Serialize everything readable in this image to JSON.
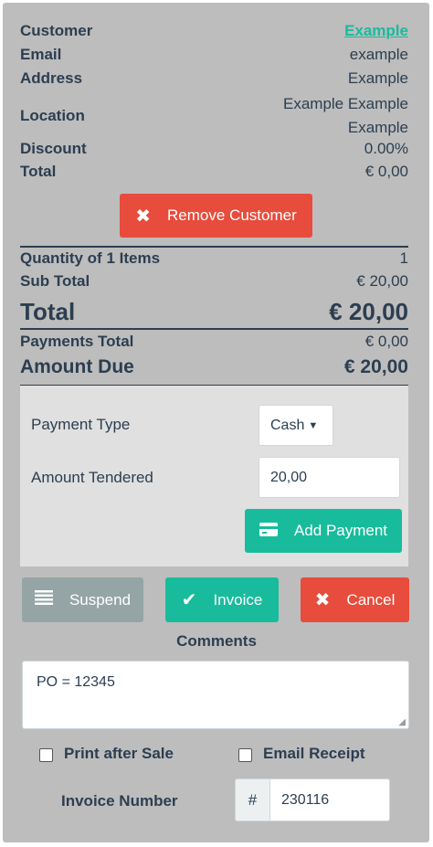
{
  "customer": {
    "customer_label": "Customer",
    "customer_value": "Example",
    "email_label": "Email",
    "email_value": "example",
    "address_label": "Address",
    "address_value": "Example",
    "location_label": "Location",
    "location_line1": "Example Example",
    "location_line2": "Example",
    "discount_label": "Discount",
    "discount_value": "0.00%",
    "total_label": "Total",
    "total_value": "€ 0,00",
    "remove_label": "Remove Customer"
  },
  "summary": {
    "qty_label": "Quantity of 1 Items",
    "qty_value": "1",
    "subtotal_label": "Sub Total",
    "subtotal_value": "€ 20,00",
    "total_label": "Total",
    "total_value": "€ 20,00",
    "payments_label": "Payments Total",
    "payments_value": "€ 0,00",
    "due_label": "Amount Due",
    "due_value": "€ 20,00"
  },
  "payment": {
    "type_label": "Payment Type",
    "type_value": "Cash",
    "tendered_label": "Amount Tendered",
    "tendered_value": "20,00",
    "add_label": "Add Payment"
  },
  "actions": {
    "suspend": "Suspend",
    "invoice": "Invoice",
    "cancel": "Cancel"
  },
  "comments": {
    "label": "Comments",
    "value": "PO = 12345"
  },
  "options": {
    "print_label": "Print after Sale",
    "email_label": "Email Receipt"
  },
  "invoice": {
    "label": "Invoice Number",
    "prefix": "#",
    "value": "230116"
  },
  "colors": {
    "accent": "#18bc9c",
    "danger": "#e74c3c",
    "neutral": "#95a5a6",
    "text": "#2c3e50"
  },
  "icons": {
    "remove": "close-icon",
    "add": "credit-card-icon",
    "suspend": "list-icon",
    "invoice": "check-icon",
    "cancel": "close-icon"
  }
}
